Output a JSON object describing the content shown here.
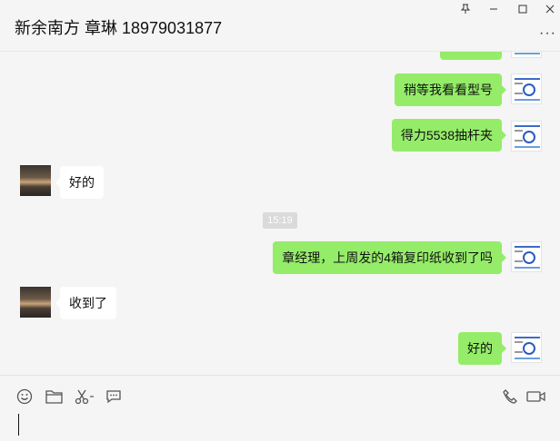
{
  "header": {
    "chat_title": "新余南方 章琳 18979031877"
  },
  "messages": [
    {
      "side": "me",
      "text": ""
    },
    {
      "side": "me",
      "text": "稍等我看看型号"
    },
    {
      "side": "me",
      "text": "得力5538抽杆夹"
    },
    {
      "side": "other",
      "text": "好的"
    },
    {
      "type": "time",
      "text": "15:19"
    },
    {
      "side": "me",
      "text": "章经理，上周发的4箱复印纸收到了吗"
    },
    {
      "side": "other",
      "text": "收到了"
    },
    {
      "side": "me",
      "text": "好的"
    }
  ],
  "toolbar": {
    "icons": [
      "emoji-icon",
      "folder-icon",
      "scissors-icon",
      "chat-bubble-icon",
      "phone-icon",
      "video-icon"
    ]
  }
}
